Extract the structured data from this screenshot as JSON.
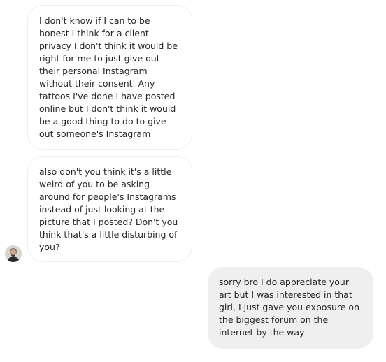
{
  "conversation": {
    "messages": [
      {
        "sender": "other",
        "text": "I don't know if I can to be honest I think for a client privacy I don't think it would be right for me to just give out their personal Instagram without their consent. Any tattoos I've done I have posted online but I don't think it would be a good thing to do to give out someone's Instagram"
      },
      {
        "sender": "other",
        "text": "also don't you think it's a little weird of you to be asking around for people's Instagrams instead of just looking at the picture that I posted? Don't you think that's a little disturbing of you?"
      },
      {
        "sender": "me",
        "text": "sorry bro I do appreciate your art but I was interested in that girl, I just gave you exposure on the biggest forum on the internet by the way"
      }
    ]
  },
  "avatar": {
    "icon": "person-avatar-icon"
  },
  "colors": {
    "incoming_bg": "#ffffff",
    "incoming_border": "#efefef",
    "outgoing_bg": "#efefef",
    "text": "#262626"
  }
}
